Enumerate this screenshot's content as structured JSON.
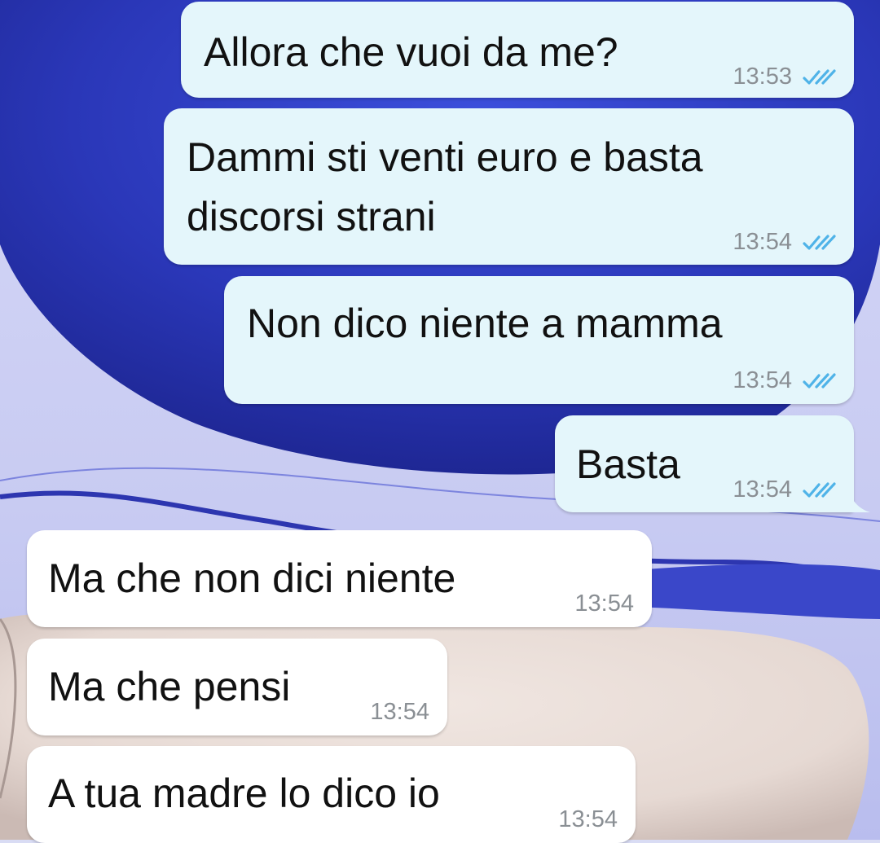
{
  "colors": {
    "outgoing_bubble": "#e4f6fb",
    "incoming_bubble": "#ffffff",
    "read_ticks": "#4fb3e8",
    "timestamp": "#8a8f94",
    "wallpaper_blue": "#2f3fc0",
    "wallpaper_sand": "#e8dcd6"
  },
  "status_icon": "double-check-read-icon",
  "messages": [
    {
      "direction": "out",
      "text": "Allora che vuoi da me?",
      "time": "13:53",
      "status": "read"
    },
    {
      "direction": "out",
      "text": "Dammi sti venti euro e basta",
      "text_line2": "discorsi strani",
      "time": "13:54",
      "status": "read"
    },
    {
      "direction": "out",
      "text": "Non dico niente a mamma",
      "time": "13:54",
      "status": "read"
    },
    {
      "direction": "out",
      "text": "Basta",
      "time": "13:54",
      "status": "read"
    },
    {
      "direction": "in",
      "text": "Ma che non dici niente",
      "time": "13:54"
    },
    {
      "direction": "in",
      "text": "Ma che pensi",
      "time": "13:54"
    },
    {
      "direction": "in",
      "text": "A tua madre lo dico io",
      "time": "13:54"
    }
  ]
}
